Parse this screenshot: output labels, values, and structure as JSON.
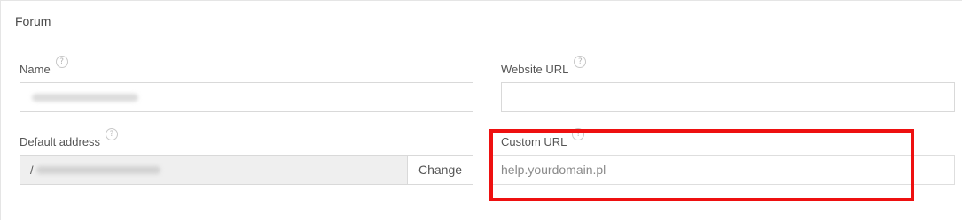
{
  "panel": {
    "title": "Forum"
  },
  "fields": {
    "name": {
      "label": "Name",
      "help": "?"
    },
    "website_url": {
      "label": "Website URL",
      "help": "?"
    },
    "default_address": {
      "label": "Default address",
      "help": "?",
      "prefix": "/",
      "button_label": "Change"
    },
    "custom_url": {
      "label": "Custom URL",
      "help": "?",
      "placeholder": "help.yourdomain.pl"
    }
  },
  "colors": {
    "highlight": "#ee1010",
    "border": "#d9d9d9",
    "readonly_bg": "#efefef"
  }
}
